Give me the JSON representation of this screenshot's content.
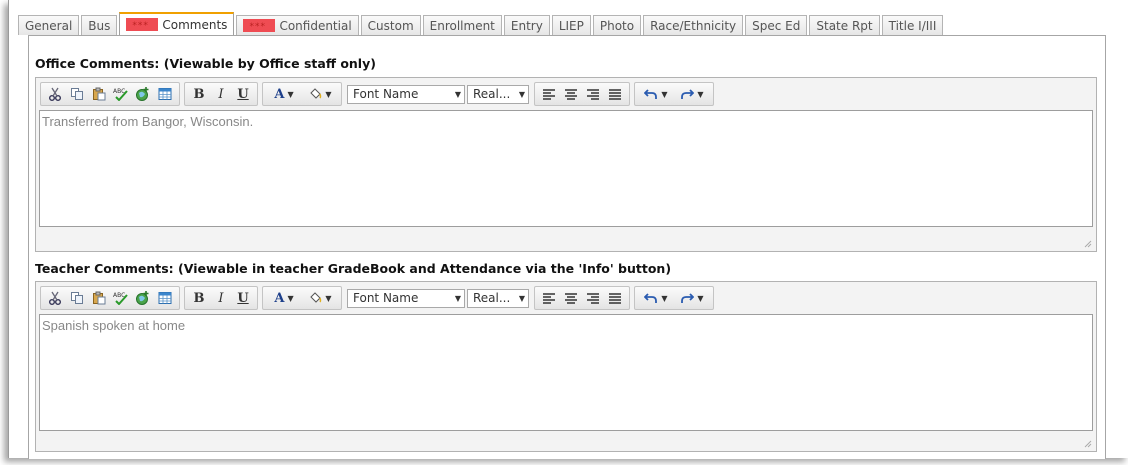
{
  "tabs": [
    {
      "label": "General",
      "flag": false,
      "active": false
    },
    {
      "label": "Bus",
      "flag": false,
      "active": false
    },
    {
      "label": "Comments",
      "flag": true,
      "active": true
    },
    {
      "label": "Confidential",
      "flag": true,
      "active": false
    },
    {
      "label": "Custom",
      "flag": false,
      "active": false
    },
    {
      "label": "Enrollment",
      "flag": false,
      "active": false
    },
    {
      "label": "Entry",
      "flag": false,
      "active": false
    },
    {
      "label": "LIEP",
      "flag": false,
      "active": false
    },
    {
      "label": "Photo",
      "flag": false,
      "active": false
    },
    {
      "label": "Race/Ethnicity",
      "flag": false,
      "active": false
    },
    {
      "label": "Spec Ed",
      "flag": false,
      "active": false
    },
    {
      "label": "State Rpt",
      "flag": false,
      "active": false
    },
    {
      "label": "Title I/III",
      "flag": false,
      "active": false
    }
  ],
  "office": {
    "title": "Office Comments: (Viewable by Office staff only)",
    "text": "Transferred from Bangor, Wisconsin."
  },
  "teacher": {
    "title": "Teacher Comments: (Viewable in teacher GradeBook and Attendance via the 'Info' button)",
    "text": "Spanish spoken at home"
  },
  "toolbar": {
    "bold": "B",
    "italic": "I",
    "underline": "U",
    "font_color": "A",
    "font_name": "Font Name",
    "font_size": "Real..."
  },
  "colors": {
    "active_tab_accent": "#f0a000",
    "flag": "#ef4c53"
  }
}
